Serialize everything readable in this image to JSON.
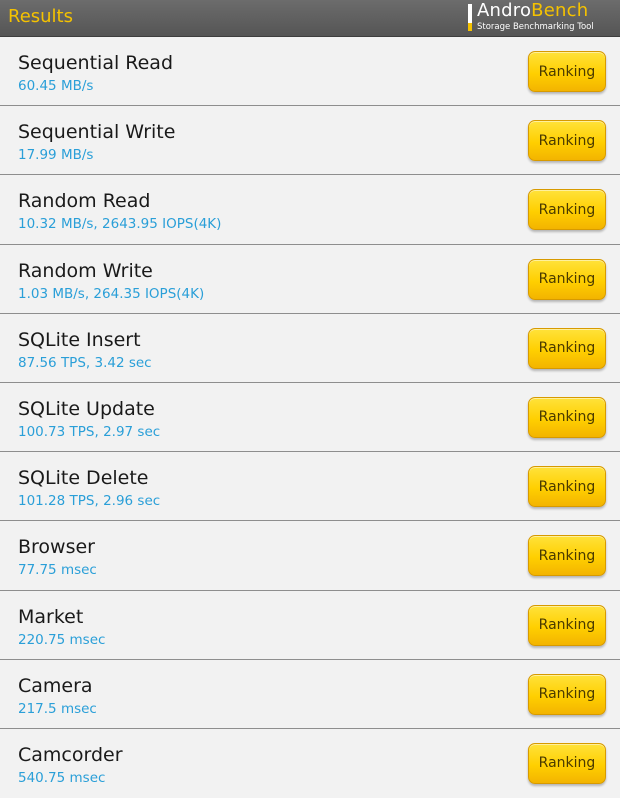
{
  "header": {
    "title": "Results",
    "logo_part1": "Andro",
    "logo_part2": "Bench",
    "logo_subtitle": "Storage Benchmarking Tool"
  },
  "colors": {
    "accent": "#f5c200",
    "value_text": "#2a9fd8",
    "button": "#ffcf00"
  },
  "results": [
    {
      "title": "Sequential Read",
      "value": "60.45 MB/s",
      "button": "Ranking"
    },
    {
      "title": "Sequential Write",
      "value": "17.99 MB/s",
      "button": "Ranking"
    },
    {
      "title": "Random Read",
      "value": "10.32 MB/s, 2643.95 IOPS(4K)",
      "button": "Ranking"
    },
    {
      "title": "Random Write",
      "value": "1.03 MB/s, 264.35 IOPS(4K)",
      "button": "Ranking"
    },
    {
      "title": "SQLite Insert",
      "value": "87.56 TPS, 3.42 sec",
      "button": "Ranking"
    },
    {
      "title": "SQLite Update",
      "value": "100.73 TPS, 2.97 sec",
      "button": "Ranking"
    },
    {
      "title": "SQLite Delete",
      "value": "101.28 TPS, 2.96 sec",
      "button": "Ranking"
    },
    {
      "title": "Browser",
      "value": "77.75 msec",
      "button": "Ranking"
    },
    {
      "title": "Market",
      "value": "220.75 msec",
      "button": "Ranking"
    },
    {
      "title": "Camera",
      "value": "217.5 msec",
      "button": "Ranking"
    },
    {
      "title": "Camcorder",
      "value": "540.75 msec",
      "button": "Ranking"
    }
  ]
}
